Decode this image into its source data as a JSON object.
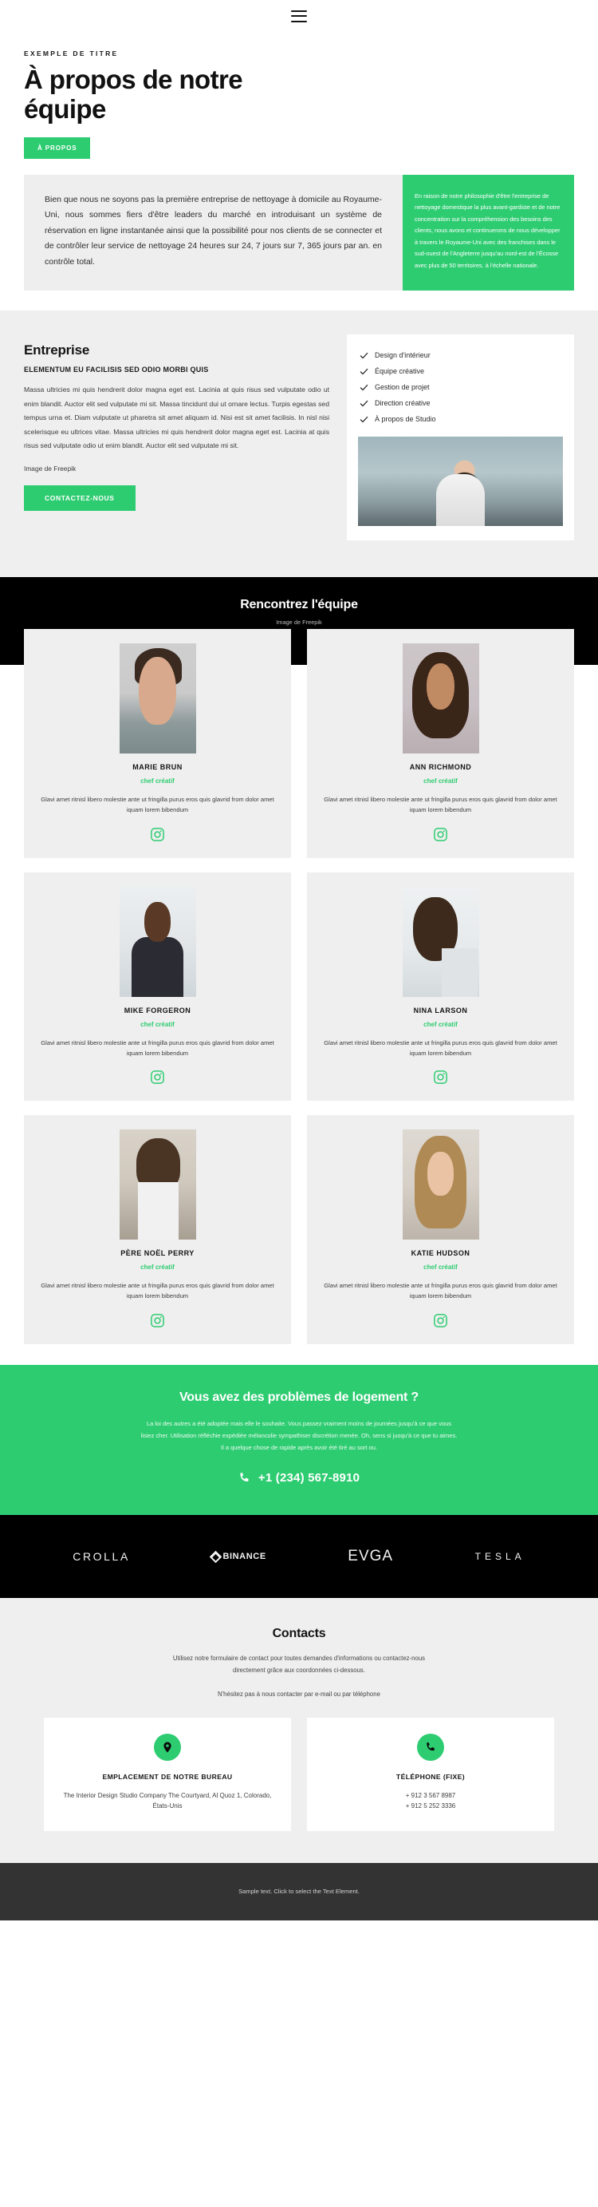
{
  "header": {
    "menu_icon": "hamburger-menu-icon"
  },
  "hero": {
    "eyebrow": "EXEMPLE DE TITRE",
    "title": "À propos de notre équipe",
    "cta_label": "À PROPOS",
    "intro_main": "Bien que nous ne soyons pas la première entreprise de nettoyage à domicile au Royaume-Uni, nous sommes fiers d'être leaders du marché en introduisant un système de réservation en ligne instantanée ainsi que la possibilité pour nos clients de se connecter et de contrôler leur service de nettoyage 24 heures sur 24, 7 jours sur 7, 365 jours par an. en contrôle total.",
    "intro_aside": "En raison de notre philosophie d'être l'entreprise de nettoyage domestique la plus avant-gardiste et de notre concentration sur la compréhension des besoins des clients, nous avons et continuerons de nous développer à travers le Royaume-Uni avec des franchises dans le sud-ouest de l'Angleterre jusqu'au nord-est de l'Écosse avec plus de 50 territoires. à l'échelle nationale."
  },
  "company": {
    "title": "Entreprise",
    "subtitle": "ELEMENTUM EU FACILISIS SED ODIO MORBI QUIS",
    "body": "Massa ultricies mi quis hendrerit dolor magna eget est. Lacinia at quis risus sed vulputate odio ut enim blandit. Auctor elit sed vulputate mi sit. Massa tincidunt dui ut ornare lectus. Turpis egestas sed tempus urna et. Diam vulputate ut pharetra sit amet aliquam id. Nisi est sit amet facilisis. In nisl nisi scelerisque eu ultrices vitae. Massa ultricies mi quis hendrerit dolor magna eget est. Lacinia at quis risus sed vulputate odio ut enim blandit. Auctor elit sed vulputate mi sit.",
    "credit": "Image de Freepik",
    "cta_label": "CONTACTEZ-NOUS",
    "checklist": [
      "Design d'intérieur",
      "Équipe créative",
      "Gestion de projet",
      "Direction créative",
      "À propos de Studio"
    ]
  },
  "team": {
    "title": "Rencontrez l'équipe",
    "credit": "Image de Freepik",
    "bio": "Glavi amet ritnisl libero molestie ante ut fringilla purus eros quis glavrid from dolor amet iquam lorem bibendum",
    "social_icon": "instagram-icon",
    "members": [
      {
        "name": "MARIE BRUN",
        "role": "chef créatif"
      },
      {
        "name": "ANN RICHMOND",
        "role": "chef créatif"
      },
      {
        "name": "MIKE FORGERON",
        "role": "chef créatif"
      },
      {
        "name": "NINA LARSON",
        "role": "chef créatif"
      },
      {
        "name": "PÈRE NOËL PERRY",
        "role": "chef créatif"
      },
      {
        "name": "KATIE HUDSON",
        "role": "chef créatif"
      }
    ]
  },
  "cta": {
    "title": "Vous avez des problèmes de logement ?",
    "body": "La loi des autres a été adoptée mais elle le souhaite. Vous passez vraiment moins de journées jusqu'à ce que vous lisiez cher. Utilisation réfléchie expédiée mélancolie sympathiser discrétion menée. Oh, sens si jusqu'à ce que tu aimes. Il a quelque chose de rapide après avoir été tiré au sort ou.",
    "phone": "+1 (234) 567-8910",
    "phone_icon": "phone-icon"
  },
  "logos": [
    {
      "name": "CROLLA",
      "style": "crolla"
    },
    {
      "name": "BINANCE",
      "style": "binance"
    },
    {
      "name": "EVGA",
      "style": "evga"
    },
    {
      "name": "TESLA",
      "style": "tesla"
    }
  ],
  "contacts": {
    "title": "Contacts",
    "body1": "Utilisez notre formulaire de contact pour toutes demandes d'informations ou contactez-nous directement grâce aux coordonnées ci-dessous.",
    "body2": "N'hésitez pas à nous contacter par e-mail ou par téléphone",
    "cards": [
      {
        "icon": "map-pin-icon",
        "label": "EMPLACEMENT DE NOTRE BUREAU",
        "lines": "The Interior Design Studio Company The Courtyard, Al Quoz 1, Colorado, États-Unis"
      },
      {
        "icon": "phone-icon",
        "label": "TÉLÉPHONE (FIXE)",
        "lines": "+ 912 3 567 8987\n+ 912 5 252 3336"
      }
    ]
  },
  "footer": {
    "text": "Sample text. Click to select the Text Element."
  },
  "colors": {
    "accent": "#2ecc71",
    "dark": "#000000",
    "light": "#efefef",
    "footer": "#333333"
  }
}
